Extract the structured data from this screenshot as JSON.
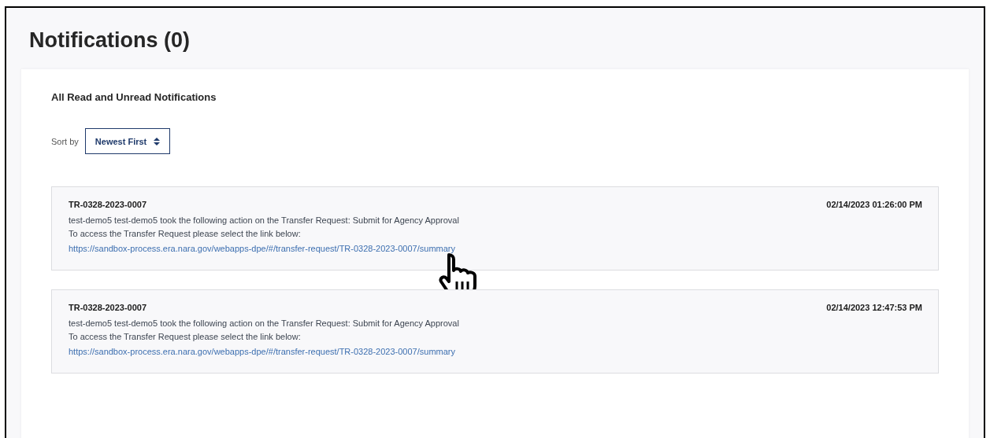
{
  "page": {
    "title": "Notifications (0)"
  },
  "section": {
    "heading": "All Read and Unread Notifications",
    "sort_label": "Sort by",
    "sort_value": "Newest First"
  },
  "notifications": [
    {
      "id": "TR-0328-2023-0007",
      "date": "02/14/2023 01:26:00 PM",
      "message": "test-demo5 test-demo5 took the following action on the Transfer Request: Submit for Agency Approval",
      "instruction": "To access the Transfer Request please select the link below:",
      "link": "https://sandbox-process.era.nara.gov/webapps-dpe/#/transfer-request/TR-0328-2023-0007/summary",
      "pointer": true
    },
    {
      "id": "TR-0328-2023-0007",
      "date": "02/14/2023 12:47:53 PM",
      "message": "test-demo5 test-demo5 took the following action on the Transfer Request: Submit for Agency Approval",
      "instruction": "To access the Transfer Request please select the link below:",
      "link": "https://sandbox-process.era.nara.gov/webapps-dpe/#/transfer-request/TR-0328-2023-0007/summary",
      "pointer": false
    }
  ]
}
